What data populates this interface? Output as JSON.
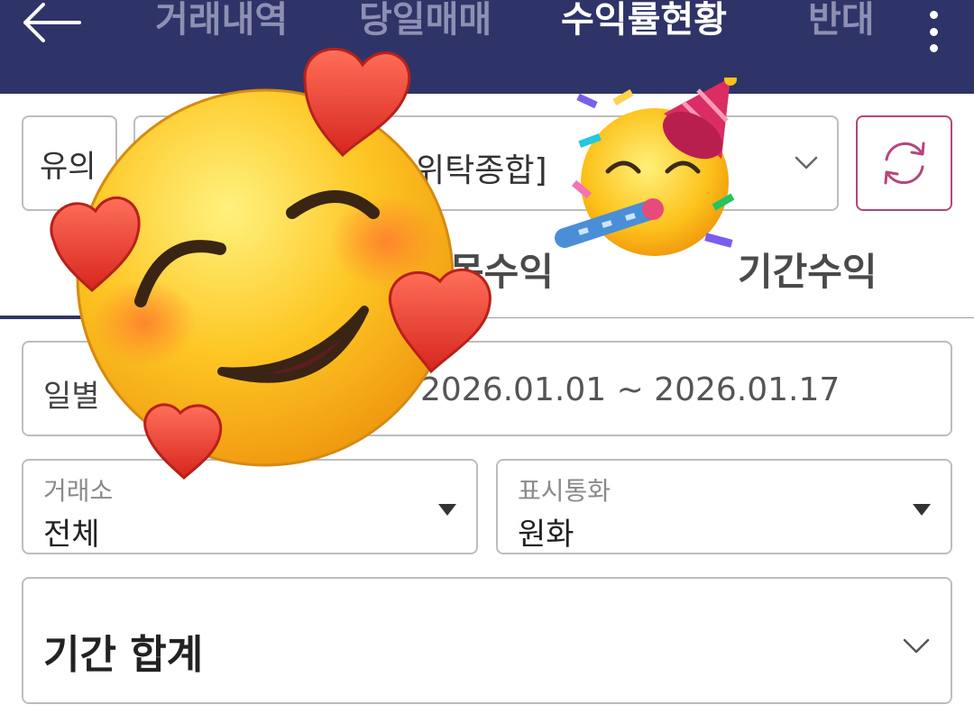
{
  "header": {
    "tabs": [
      {
        "label": "거래내역",
        "active": false
      },
      {
        "label": "당일매매",
        "active": false
      },
      {
        "label": "수익률현황",
        "active": true
      },
      {
        "label": "반대",
        "active": false
      }
    ],
    "icons": {
      "back": "arrow-left-icon",
      "more": "more-vertical-icon"
    }
  },
  "account_bar": {
    "note_label": "유의",
    "account_text": "위탁종합]",
    "icons": {
      "dropdown": "chevron-down-icon",
      "refresh": "refresh-icon"
    }
  },
  "sub_tabs": [
    {
      "label": "목수익",
      "active": false
    },
    {
      "label": "기간수익",
      "active": false
    }
  ],
  "period": {
    "label": "일별",
    "range": "2026.01.01 ~ 2026.01.17"
  },
  "filters": {
    "exchange": {
      "label": "거래소",
      "value": "전체"
    },
    "currency": {
      "label": "표시통화",
      "value": "원화"
    }
  },
  "summary": {
    "title": "기간 합계"
  },
  "colors": {
    "header_bg": "#2f3468",
    "active_tab": "#ffffff",
    "inactive_tab": "#8d90b3",
    "refresh_accent": "#b7457a",
    "border": "#bdbdbd"
  },
  "overlays": [
    "smiling-face-with-hearts-emoji",
    "partying-face-emoji"
  ]
}
